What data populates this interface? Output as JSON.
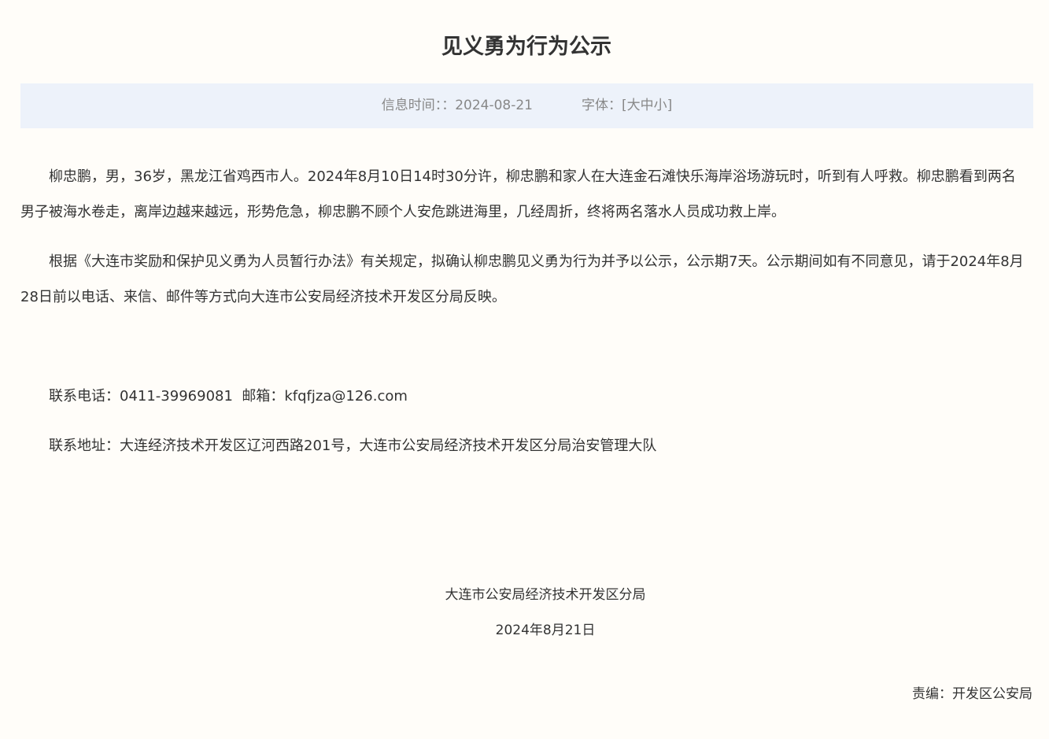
{
  "title": "见义勇为行为公示",
  "info_bar": {
    "time_label": "信息时间：：",
    "date": "2024-08-21",
    "font_label": "字体：",
    "font_open": "[",
    "font_large": "大",
    "font_medium": "中",
    "font_small": "小",
    "font_close": "]"
  },
  "body": {
    "paragraph_1": "柳忠鹏，男，36岁，黑龙江省鸡西市人。2024年8月10日14时30分许，柳忠鹏和家人在大连金石滩快乐海岸浴场游玩时，听到有人呼救。柳忠鹏看到两名男子被海水卷走，离岸边越来越远，形势危急，柳忠鹏不顾个人安危跳进海里，几经周折，终将两名落水人员成功救上岸。",
    "paragraph_2": "根据《大连市奖励和保护见义勇为人员暂行办法》有关规定，拟确认柳忠鹏见义勇为行为并予以公示，公示期7天。公示期间如有不同意见，请于2024年8月28日前以电话、来信、邮件等方式向大连市公安局经济技术开发区分局反映。"
  },
  "contact": {
    "phone_line": "联系电话：0411-39969081  邮箱：kfqfjza@126.com",
    "address_line": "联系地址：大连经济技术开发区辽河西路201号，大连市公安局经济技术开发区分局治安管理大队"
  },
  "signature": {
    "organization": "大连市公安局经济技术开发区分局",
    "date": "2024年8月21日"
  },
  "editor": "责编：开发区公安局"
}
